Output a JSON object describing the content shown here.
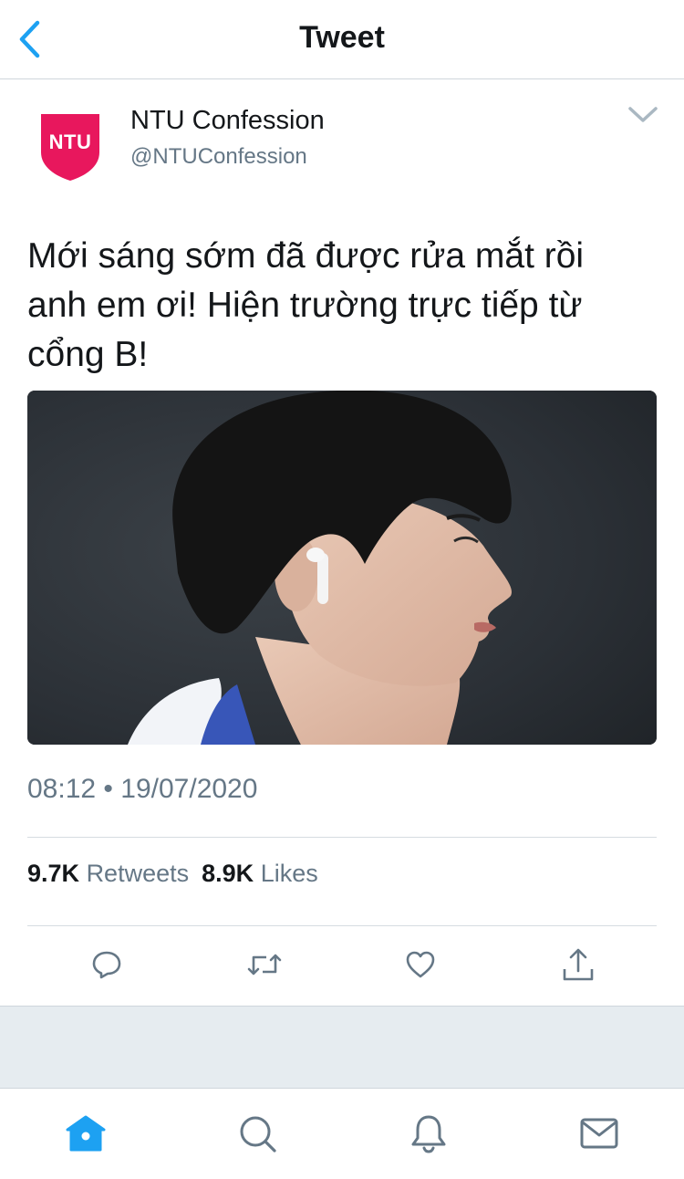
{
  "header": {
    "title": "Tweet"
  },
  "author": {
    "logo_text": "NTU",
    "name": "NTU Confession",
    "handle": "@NTUConfession"
  },
  "tweet": {
    "lines": [
      "Mới sáng sớm đã được rửa mắt rồi",
      "anh em ơi! Hiện trường trực tiếp từ",
      "cổng B!"
    ],
    "time": "08:12",
    "separator": "•",
    "date": "19/07/2020"
  },
  "stats": {
    "retweets_count": "9.7K",
    "retweets_label": "Retweets",
    "likes_count": "8.9K",
    "likes_label": "Likes"
  },
  "icons": {
    "back": "chevron-left-icon",
    "caret": "chevron-down-icon",
    "reply": "reply-icon",
    "retweet": "retweet-icon",
    "like": "heart-icon",
    "share": "share-icon",
    "home": "home-icon",
    "search": "search-icon",
    "notifications": "bell-icon",
    "messages": "mail-icon"
  },
  "colors": {
    "accent": "#1da1f2",
    "brand": "#e8175d",
    "muted": "#657786",
    "text": "#14171a",
    "band": "#e6ecf0"
  }
}
